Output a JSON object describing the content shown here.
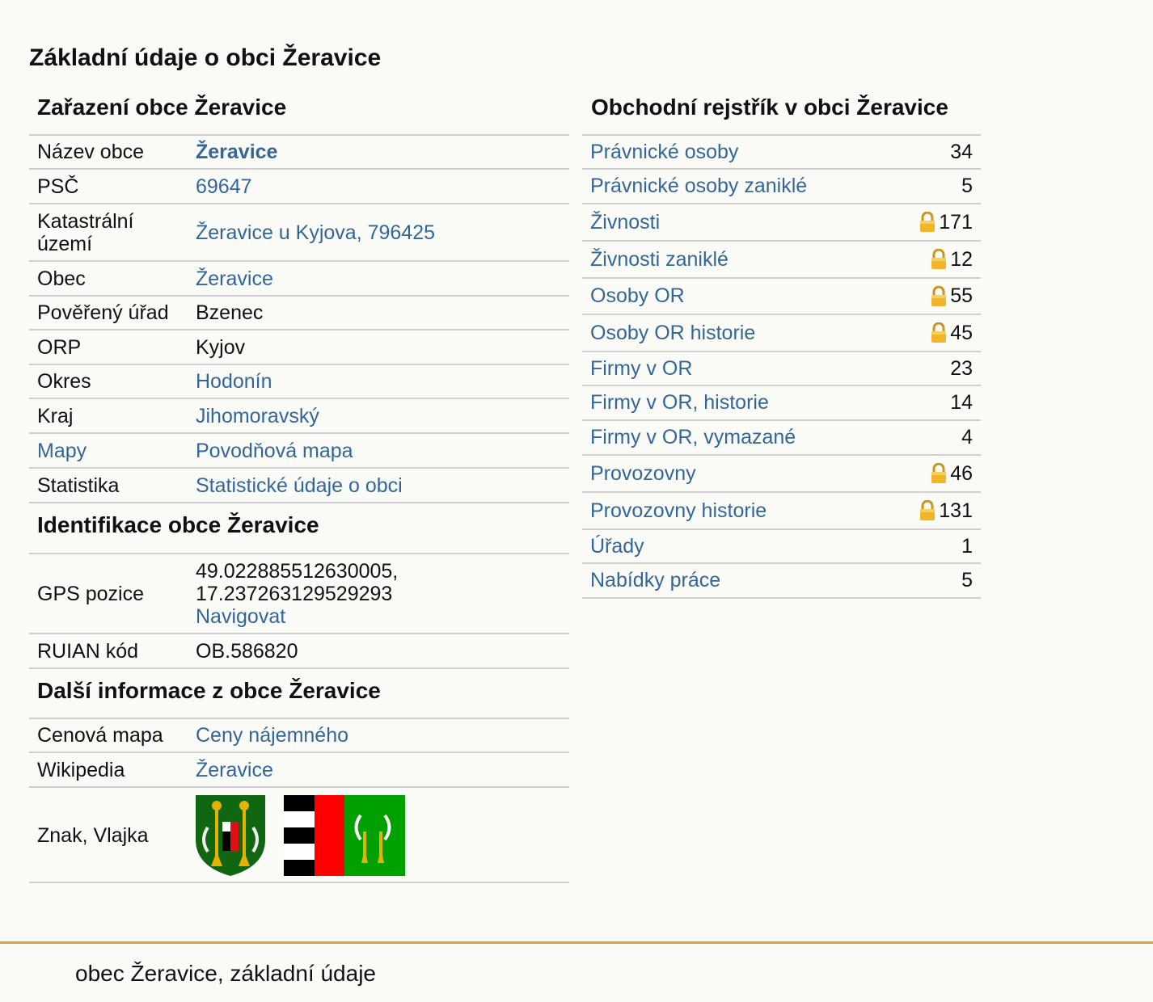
{
  "page_title": "Základní údaje o obci Žeravice",
  "zarazeni": {
    "title": "Zařazení obce Žeravice",
    "rows": [
      {
        "key": "Název obce",
        "value": "Žeravice"
      },
      {
        "key": "PSČ",
        "value": "69647"
      },
      {
        "key": "Katastrální území",
        "value": "Žeravice u Kyjova, 796425"
      },
      {
        "key": "Obec",
        "value": "Žeravice"
      },
      {
        "key": "Pověřený úřad",
        "value": "Bzenec"
      },
      {
        "key": "ORP",
        "value": "Kyjov"
      },
      {
        "key": "Okres",
        "value": "Hodonín"
      },
      {
        "key": "Kraj",
        "value": "Jihomoravský"
      },
      {
        "key": "Mapy",
        "value": "Povodňová mapa"
      },
      {
        "key": "Statistika",
        "value": "Statistické údaje o obci"
      }
    ]
  },
  "identifikace": {
    "title": "Identifikace obce Žeravice",
    "gps_key": "GPS pozice",
    "gps_lat": "49.022885512630005,",
    "gps_lon": "17.237263129529293",
    "gps_nav": "Navigovat",
    "ruian_key": "RUIAN kód",
    "ruian_value": "OB.586820"
  },
  "dalsi": {
    "title": "Další informace z obce Žeravice",
    "cenova_key": "Cenová mapa",
    "cenova_value": "Ceny nájemného",
    "wiki_key": "Wikipedia",
    "wiki_value": "Žeravice",
    "znak_key": "Znak, Vlajka"
  },
  "obchodni": {
    "title": "Obchodní rejstřík v obci Žeravice",
    "rows": [
      {
        "label": "Právnické osoby",
        "count": "34",
        "locked": false
      },
      {
        "label": "Právnické osoby zaniklé",
        "count": "5",
        "locked": false
      },
      {
        "label": "Živnosti",
        "count": "171",
        "locked": true
      },
      {
        "label": "Živnosti zaniklé",
        "count": "12",
        "locked": true
      },
      {
        "label": "Osoby OR",
        "count": "55",
        "locked": true
      },
      {
        "label": "Osoby OR historie",
        "count": "45",
        "locked": true
      },
      {
        "label": "Firmy v OR",
        "count": "23",
        "locked": false
      },
      {
        "label": "Firmy v OR, historie",
        "count": "14",
        "locked": false
      },
      {
        "label": "Firmy v OR, vymazané",
        "count": "4",
        "locked": false
      },
      {
        "label": "Provozovny",
        "count": "46",
        "locked": true
      },
      {
        "label": "Provozovny historie",
        "count": "131",
        "locked": true
      },
      {
        "label": "Úřady",
        "count": "1",
        "locked": false
      },
      {
        "label": "Nabídky práce",
        "count": "5",
        "locked": false
      }
    ]
  },
  "footer_text": "obec Žeravice, základní údaje",
  "colors": {
    "link": "#336699",
    "accent": "#d7a82a",
    "flag_green": "#00a000",
    "flag_red": "#ff0000"
  },
  "icons": {
    "lock": "lock-icon",
    "coat_of_arms": "coat-of-arms-image",
    "flag": "flag-image"
  }
}
